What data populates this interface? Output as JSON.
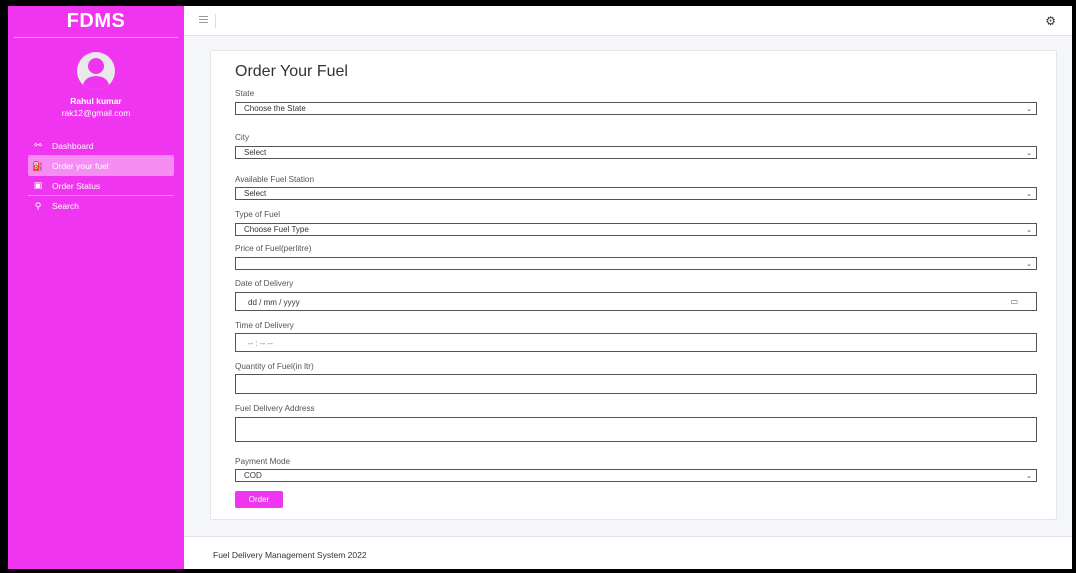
{
  "app": {
    "brand": "FDMS"
  },
  "user": {
    "name": "Rahul kumar",
    "email": "rak12@gmail.com"
  },
  "sidebar": {
    "items": [
      {
        "label": "Dashboard",
        "icon": "palette-icon"
      },
      {
        "label": "Order your fuel",
        "icon": "fuel-pump-icon",
        "active": true
      },
      {
        "label": "Order Status",
        "icon": "file-icon"
      },
      {
        "label": "Search",
        "icon": "search-icon"
      }
    ]
  },
  "form": {
    "title": "Order Your Fuel",
    "state": {
      "label": "State",
      "value": "Choose the State"
    },
    "city": {
      "label": "City",
      "value": "Select"
    },
    "station": {
      "label": "Available Fuel Station",
      "value": "Select"
    },
    "fuel_type": {
      "label": "Type of Fuel",
      "value": "Choose Fuel Type"
    },
    "price": {
      "label": "Price of Fuel(perlitre)",
      "value": ""
    },
    "date": {
      "label": "Date of Delivery",
      "placeholder": "dd / mm / yyyy"
    },
    "time": {
      "label": "Time of Delivery",
      "placeholder": "-- : -- --"
    },
    "quantity": {
      "label": "Quantity of Fuel(in ltr)",
      "value": ""
    },
    "address": {
      "label": "Fuel Delivery Address",
      "value": ""
    },
    "payment": {
      "label": "Payment Mode",
      "value": "COD"
    },
    "submit_label": "Order"
  },
  "footer": {
    "text": "Fuel Delivery Management System 2022"
  },
  "colors": {
    "accent": "#ef35ef",
    "active_item": "#f58df5"
  }
}
